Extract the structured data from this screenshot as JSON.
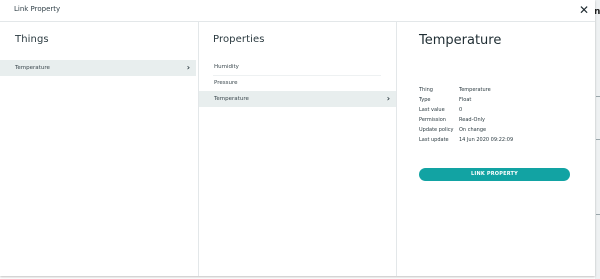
{
  "dialog": {
    "title": "Link Property",
    "close_glyph": "✕"
  },
  "things": {
    "heading": "Things",
    "items": [
      {
        "label": "Temperature",
        "selected": true
      }
    ]
  },
  "properties": {
    "heading": "Properties",
    "items": [
      {
        "label": "Humidity",
        "selected": false
      },
      {
        "label": "Pressure",
        "selected": false
      },
      {
        "label": "Temperature",
        "selected": true
      }
    ]
  },
  "detail": {
    "title": "Temperature",
    "rows": [
      {
        "key": "Thing",
        "value": "Temperature"
      },
      {
        "key": "Type",
        "value": "Float"
      },
      {
        "key": "Last value",
        "value": "0"
      },
      {
        "key": "Permission",
        "value": "Read-Only"
      },
      {
        "key": "Update policy",
        "value": "On change"
      },
      {
        "key": "Last update",
        "value": "14 Jun 2020 09:22:09"
      }
    ],
    "button_label": "LINK PROPERTY"
  },
  "background": {
    "partial_letter": "n"
  },
  "colors": {
    "accent": "#12a3a3",
    "selected_row": "#e8eeee"
  },
  "icons": {
    "close": "close-icon",
    "chevron": "chevron-right-icon"
  }
}
